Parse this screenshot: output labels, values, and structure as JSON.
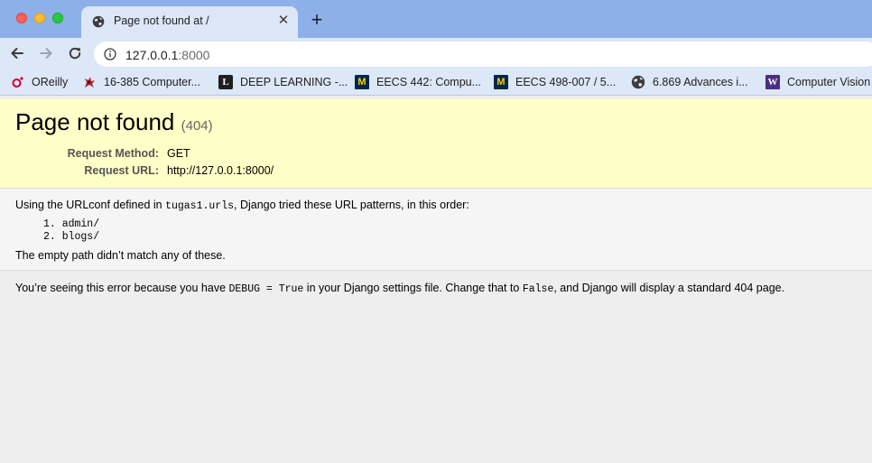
{
  "browser": {
    "tab": {
      "title": "Page not found at /",
      "icon": "globe-icon"
    },
    "address_bar": {
      "host": "127.0.0.1",
      "port": ":8000"
    },
    "bookmarks": [
      {
        "label": "OReilly",
        "icon": "oreilly-icon",
        "icon_color": "#d3002d"
      },
      {
        "label": "16-385 Computer...",
        "icon": "cmu-griffin-icon",
        "icon_color": "#b3242c"
      },
      {
        "label": "DEEP LEARNING -...",
        "icon": "l-logo-icon",
        "icon_color": "#1f1f1f"
      },
      {
        "label": "EECS 442: Compu...",
        "icon": "umich-m-icon",
        "icon_color": "#00274c"
      },
      {
        "label": "EECS 498-007 / 5...",
        "icon": "umich-m-icon",
        "icon_color": "#00274c"
      },
      {
        "label": "6.869 Advances i...",
        "icon": "globe-icon",
        "icon_color": "#3c3c3c"
      },
      {
        "label": "Computer Vision",
        "icon": "uw-w-icon",
        "icon_color": "#4b2e83"
      }
    ]
  },
  "summary": {
    "title": "Page not found",
    "status_code": "(404)",
    "request_method_label": "Request Method:",
    "request_method": "GET",
    "request_url_label": "Request URL:",
    "request_url": "http://127.0.0.1:8000/"
  },
  "info": {
    "intro_prefix": "Using the URLconf defined in ",
    "urlconf": "tugas1.urls",
    "intro_suffix": ", Django tried these URL patterns, in this order:",
    "patterns": [
      "1. admin/",
      "2. blogs/"
    ],
    "no_match": "The empty path didn’t match any of these."
  },
  "explanation": {
    "prefix": "You’re seeing this error because you have ",
    "debug_setting": "DEBUG = True",
    "middle": " in your Django settings file. Change that to ",
    "false_value": "False",
    "suffix": ", and Django will display a standard 404 page."
  },
  "colors": {
    "tabstrip": "#8db0e8",
    "toolbar": "#dce7f8",
    "summary_bg": "#ffffc8",
    "info_bg": "#f5f5f5",
    "explanation_bg": "#eeeeee"
  }
}
